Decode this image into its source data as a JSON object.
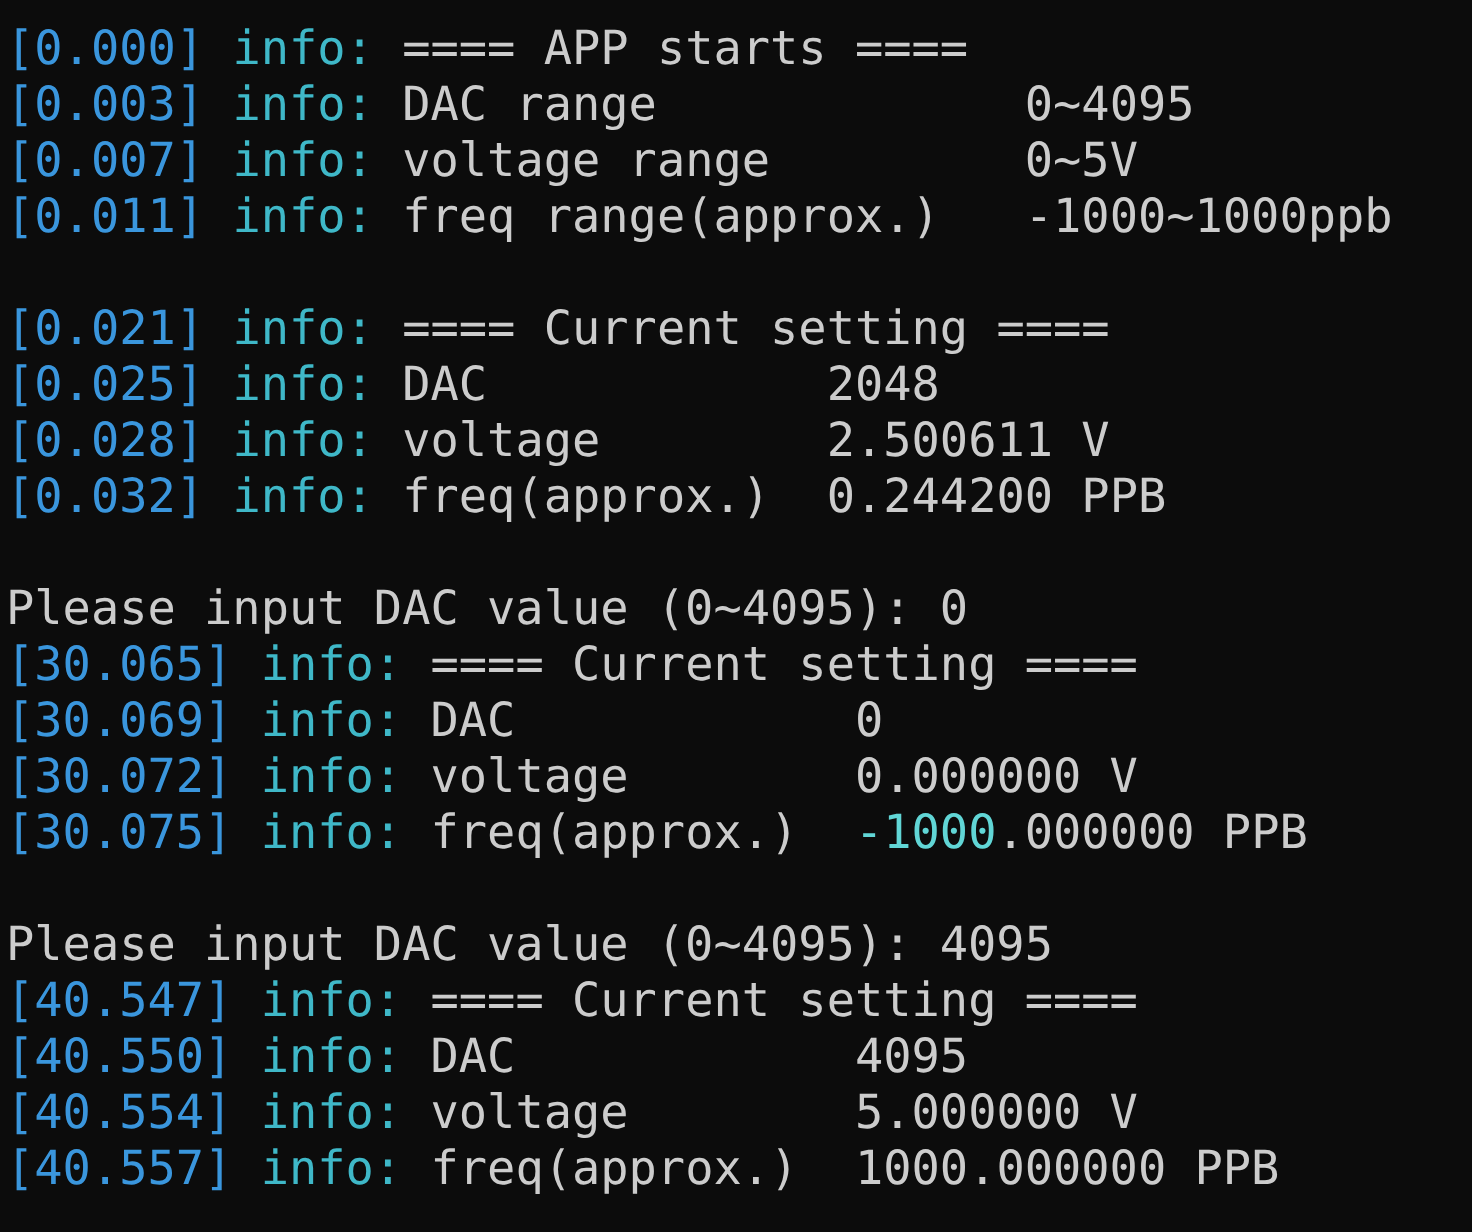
{
  "lines": [
    {
      "kind": "log",
      "timestamp": "[0.000]",
      "level": "info:",
      "message": [
        {
          "text": "==== APP starts ====",
          "highlight": false
        }
      ]
    },
    {
      "kind": "log",
      "timestamp": "[0.003]",
      "level": "info:",
      "message": [
        {
          "text": "DAC range             0~4095",
          "highlight": false
        }
      ]
    },
    {
      "kind": "log",
      "timestamp": "[0.007]",
      "level": "info:",
      "message": [
        {
          "text": "voltage range         0~5V",
          "highlight": false
        }
      ]
    },
    {
      "kind": "log",
      "timestamp": "[0.011]",
      "level": "info:",
      "message": [
        {
          "text": "freq range(approx.)   -1000~1000ppb",
          "highlight": false
        }
      ]
    },
    {
      "kind": "blank"
    },
    {
      "kind": "log",
      "timestamp": "[0.021]",
      "level": "info:",
      "message": [
        {
          "text": "==== Current setting ====",
          "highlight": false
        }
      ]
    },
    {
      "kind": "log",
      "timestamp": "[0.025]",
      "level": "info:",
      "message": [
        {
          "text": "DAC            2048",
          "highlight": false
        }
      ]
    },
    {
      "kind": "log",
      "timestamp": "[0.028]",
      "level": "info:",
      "message": [
        {
          "text": "voltage        2.500611 V",
          "highlight": false
        }
      ]
    },
    {
      "kind": "log",
      "timestamp": "[0.032]",
      "level": "info:",
      "message": [
        {
          "text": "freq(approx.)  0.244200 PPB",
          "highlight": false
        }
      ]
    },
    {
      "kind": "blank"
    },
    {
      "kind": "prompt",
      "text": "Please input DAC value (0~4095): 0"
    },
    {
      "kind": "log",
      "timestamp": "[30.065]",
      "level": "info:",
      "message": [
        {
          "text": "==== Current setting ====",
          "highlight": false
        }
      ]
    },
    {
      "kind": "log",
      "timestamp": "[30.069]",
      "level": "info:",
      "message": [
        {
          "text": "DAC            0",
          "highlight": false
        }
      ]
    },
    {
      "kind": "log",
      "timestamp": "[30.072]",
      "level": "info:",
      "message": [
        {
          "text": "voltage        0.000000 V",
          "highlight": false
        }
      ]
    },
    {
      "kind": "log",
      "timestamp": "[30.075]",
      "level": "info:",
      "message": [
        {
          "text": "freq(approx.)  ",
          "highlight": false
        },
        {
          "text": "-1000",
          "highlight": true
        },
        {
          "text": ".000000 PPB",
          "highlight": false
        }
      ]
    },
    {
      "kind": "blank"
    },
    {
      "kind": "prompt",
      "text": "Please input DAC value (0~4095): 4095"
    },
    {
      "kind": "log",
      "timestamp": "[40.547]",
      "level": "info:",
      "message": [
        {
          "text": "==== Current setting ====",
          "highlight": false
        }
      ]
    },
    {
      "kind": "log",
      "timestamp": "[40.550]",
      "level": "info:",
      "message": [
        {
          "text": "DAC            4095",
          "highlight": false
        }
      ]
    },
    {
      "kind": "log",
      "timestamp": "[40.554]",
      "level": "info:",
      "message": [
        {
          "text": "voltage        5.000000 V",
          "highlight": false
        }
      ]
    },
    {
      "kind": "log",
      "timestamp": "[40.557]",
      "level": "info:",
      "message": [
        {
          "text": "freq(approx.)  1000.000000 PPB",
          "highlight": false
        }
      ]
    }
  ]
}
